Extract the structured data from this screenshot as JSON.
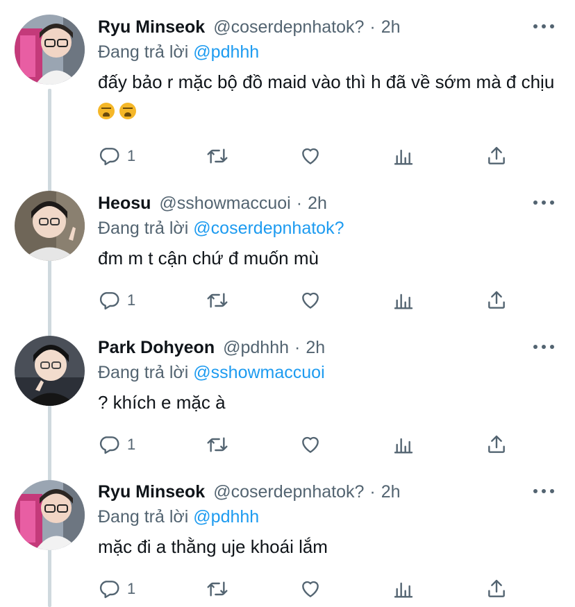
{
  "tweets": [
    {
      "name": "Ryu Minseok",
      "handle": "@coserdepnhatok?",
      "separator": "·",
      "time": "2h",
      "reply_prefix": "Đang trả lời",
      "reply_to": "@pdhhh",
      "text": "đấy bảo r mặc bộ đồ maid vào thì h đã về sớm mà đ chịu",
      "emojis": [
        "tired-face-emoji",
        "tired-face-emoji"
      ],
      "reply_count": "1"
    },
    {
      "name": "Heosu",
      "handle": "@sshowmaccuoi",
      "separator": "·",
      "time": "2h",
      "reply_prefix": "Đang trả lời",
      "reply_to": "@coserdepnhatok?",
      "text": "đm m t cận chứ đ muốn mù",
      "reply_count": "1"
    },
    {
      "name": "Park Dohyeon",
      "handle": "@pdhhh",
      "separator": "·",
      "time": "2h",
      "reply_prefix": "Đang trả lời",
      "reply_to": "@sshowmaccuoi",
      "text": "? khích e mặc à",
      "reply_count": "1"
    },
    {
      "name": "Ryu Minseok",
      "handle": "@coserdepnhatok?",
      "separator": "·",
      "time": "2h",
      "reply_prefix": "Đang trả lời",
      "reply_to": "@pdhhh",
      "text": "mặc đi a thằng uje khoái lắm",
      "reply_count": "1"
    }
  ],
  "icons": [
    "reply-icon",
    "retweet-icon",
    "like-icon",
    "analytics-icon",
    "share-icon",
    "more-icon"
  ],
  "colors": {
    "text": "#0f1419",
    "secondary": "#536471",
    "link": "#1d9bf0",
    "thread_line": "#cfd9de"
  }
}
